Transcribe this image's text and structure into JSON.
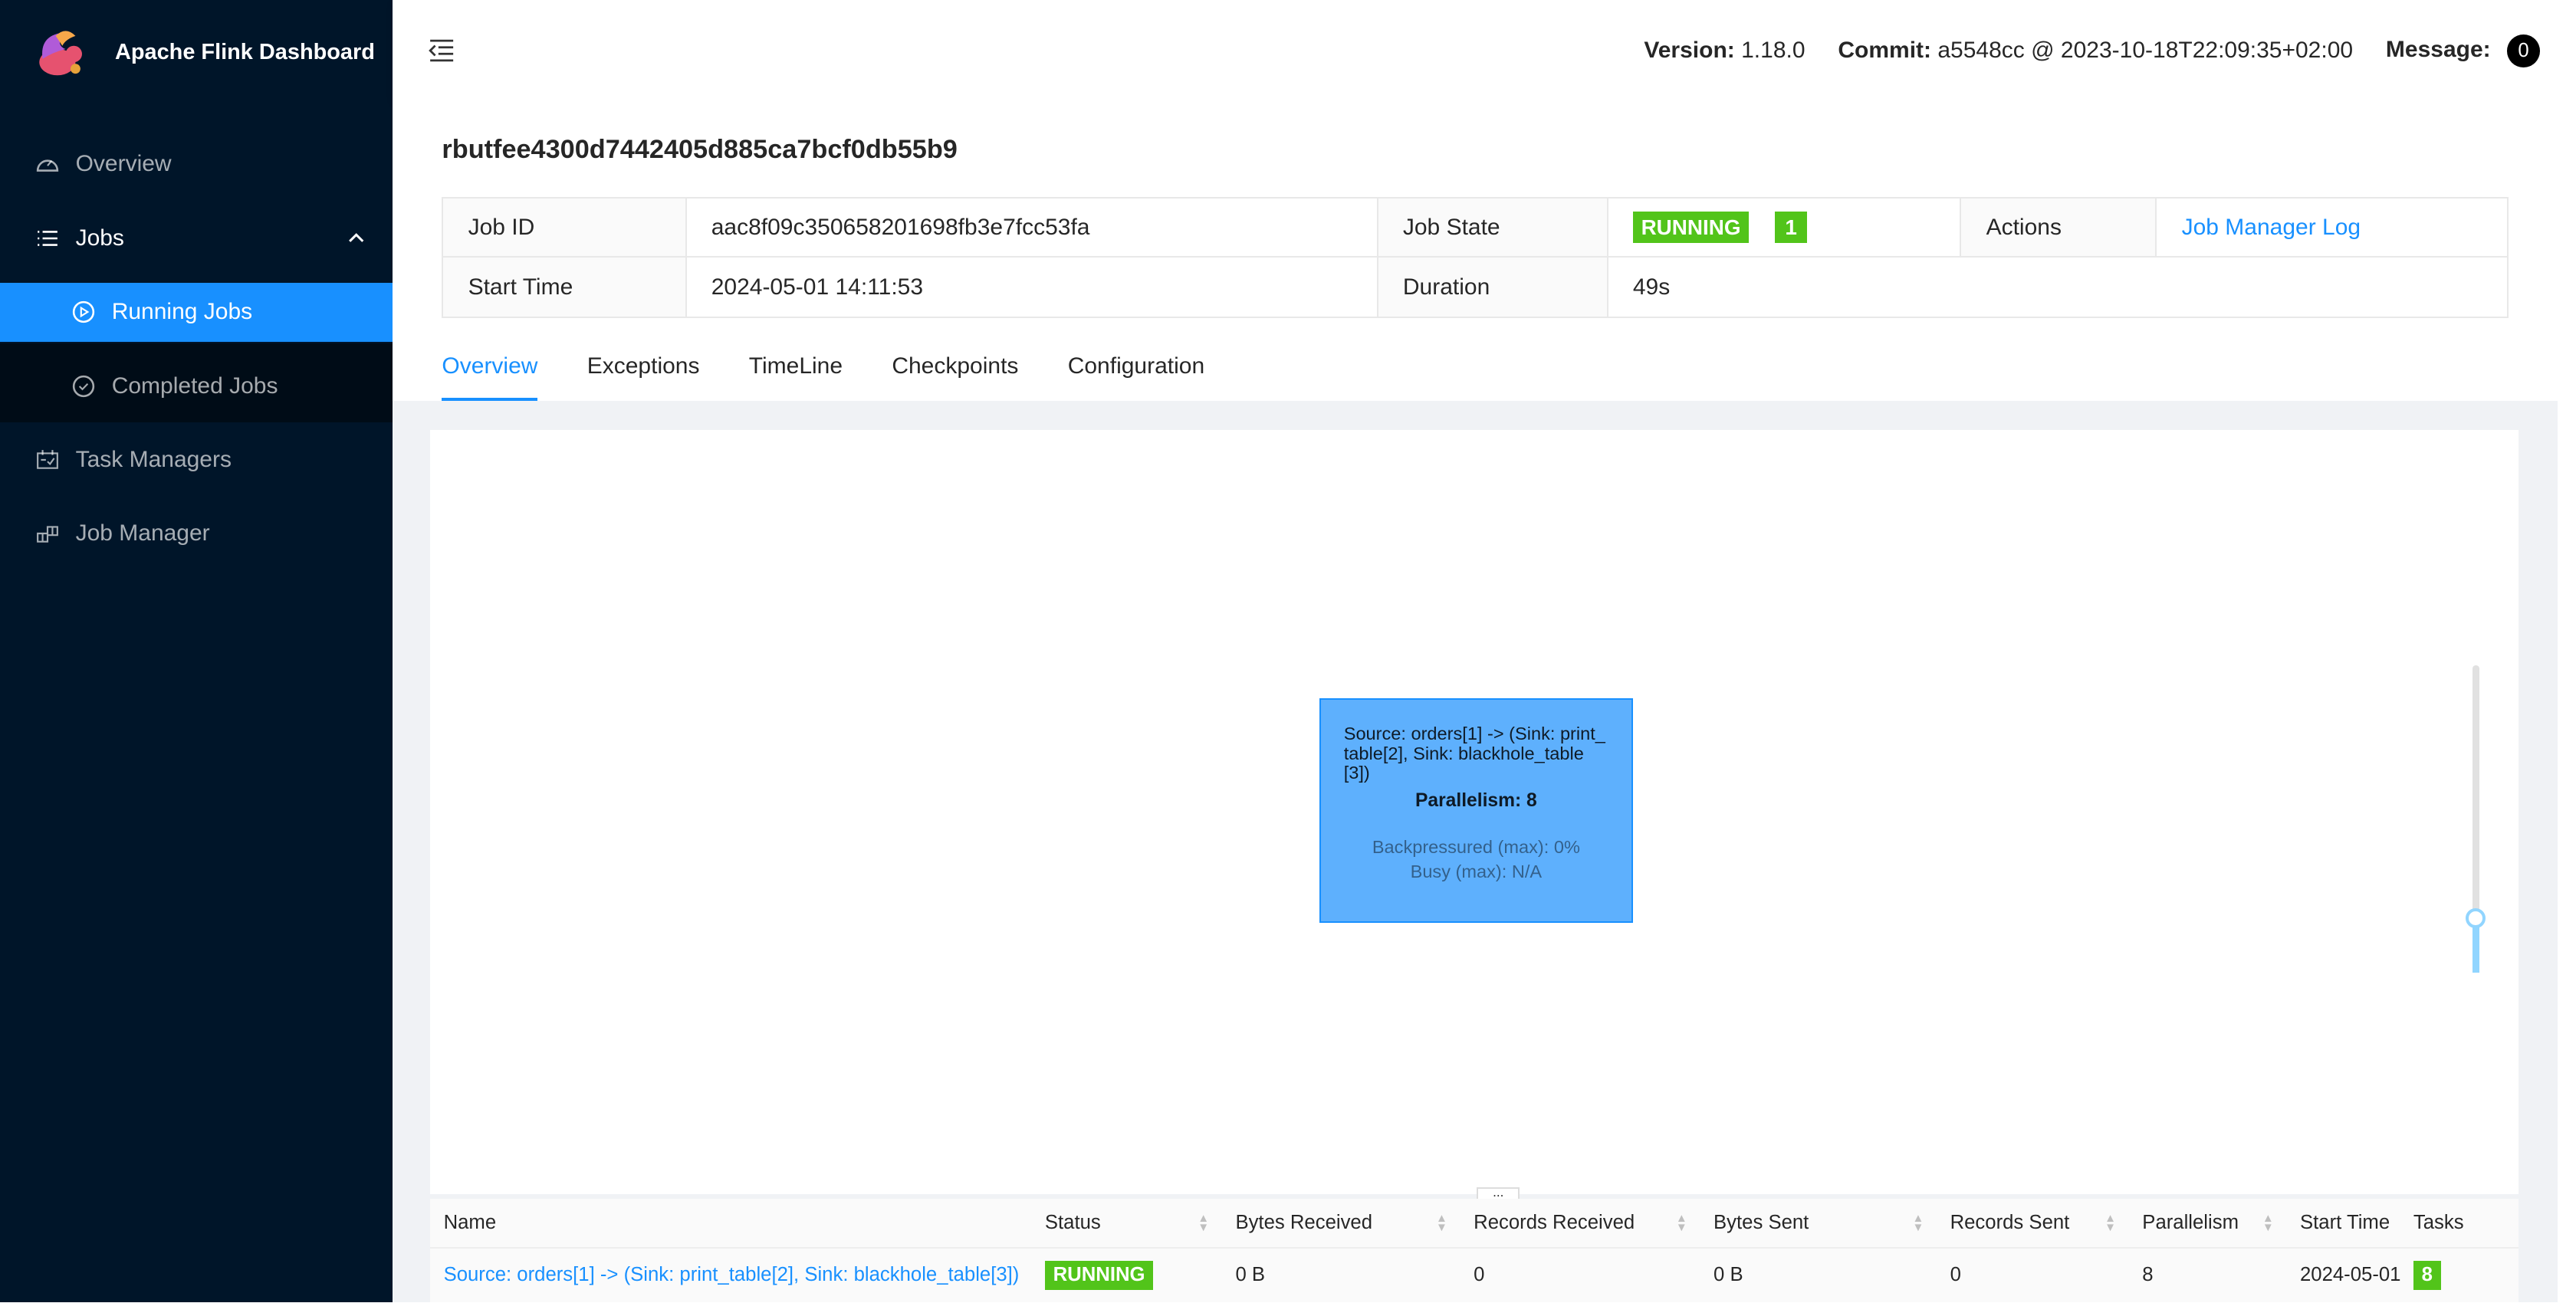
{
  "app": {
    "title": "Apache Flink Dashboard"
  },
  "sidebar": {
    "items": [
      {
        "label": "Overview",
        "icon": "dashboard-icon"
      },
      {
        "label": "Jobs",
        "icon": "list-icon"
      },
      {
        "label": "Running Jobs",
        "icon": "play-circle-icon"
      },
      {
        "label": "Completed Jobs",
        "icon": "check-circle-icon"
      },
      {
        "label": "Task Managers",
        "icon": "schedule-icon"
      },
      {
        "label": "Job Manager",
        "icon": "build-icon"
      }
    ]
  },
  "header": {
    "version_label": "Version:",
    "version": "1.18.0",
    "commit_label": "Commit:",
    "commit": "a5548cc @ 2023-10-18T22:09:35+02:00",
    "message_label": "Message:",
    "message_count": "0"
  },
  "job": {
    "name": "rbutfee4300d7442405d885ca7bcf0db55b9",
    "id_label": "Job ID",
    "id": "aac8f09c350658201698fb3e7fcc53fa",
    "state_label": "Job State",
    "state": "RUNNING",
    "state_count": "1",
    "actions_label": "Actions",
    "actions_link": "Job Manager Log",
    "start_label": "Start Time",
    "start": "2024-05-01 14:11:53",
    "duration_label": "Duration",
    "duration": "49s",
    "state_color": "#52c41a"
  },
  "tabs": [
    "Overview",
    "Exceptions",
    "TimeLine",
    "Checkpoints",
    "Configuration"
  ],
  "graph": {
    "node": {
      "name": "Source: orders[1] -> (Sink: print_table[2], Sink: blackhole_table[3])",
      "parallelism": "Parallelism: 8",
      "backpressure": "Backpressured (max): 0%",
      "busy": "Busy (max): N/A"
    },
    "zoom_level": 0.18
  },
  "table": {
    "columns": [
      "Name",
      "Status",
      "Bytes Received",
      "Records Received",
      "Bytes Sent",
      "Records Sent",
      "Parallelism",
      "Start Time",
      "Tasks"
    ],
    "rows": [
      {
        "name": "Source: orders[1] -> (Sink: print_table[2], Sink: blackhole_table[3])",
        "status": "RUNNING",
        "bytes_received": "0 B",
        "records_received": "0",
        "bytes_sent": "0 B",
        "records_sent": "0",
        "parallelism": "8",
        "start_time": "2024-05-01",
        "tasks": "8"
      }
    ]
  }
}
